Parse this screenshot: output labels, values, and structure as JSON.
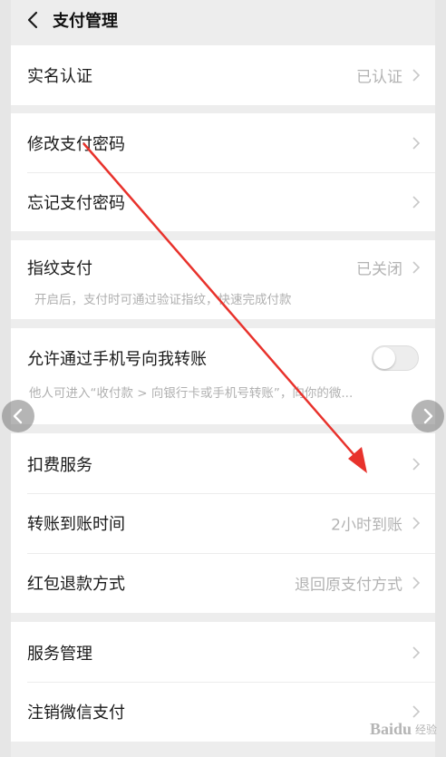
{
  "header": {
    "title": "支付管理"
  },
  "rows": {
    "real_name": {
      "label": "实名认证",
      "value": "已认证"
    },
    "change_password": {
      "label": "修改支付密码"
    },
    "forgot_password": {
      "label": "忘记支付密码"
    },
    "fingerprint": {
      "label": "指纹支付",
      "value": "已关闭",
      "hint": "开启后，支付时可通过验证指纹，快速完成付款"
    },
    "phone_transfer": {
      "label": "允许通过手机号向我转账",
      "hint": "他人可进入“收付款 > 向银行卡或手机号转账”，向你的微...",
      "enabled": false
    },
    "deduction": {
      "label": "扣费服务"
    },
    "arrival_time": {
      "label": "转账到账时间",
      "value": "2小时到账"
    },
    "refund_method": {
      "label": "红包退款方式",
      "value": "退回原支付方式"
    },
    "service_manage": {
      "label": "服务管理"
    },
    "cancel_wechat_pay": {
      "label": "注销微信支付"
    }
  },
  "colors": {
    "annotation_arrow": "#e8322c",
    "background": "#ededed",
    "card": "#ffffff"
  },
  "watermark": {
    "text": "Baidu",
    "sub": "经验"
  }
}
